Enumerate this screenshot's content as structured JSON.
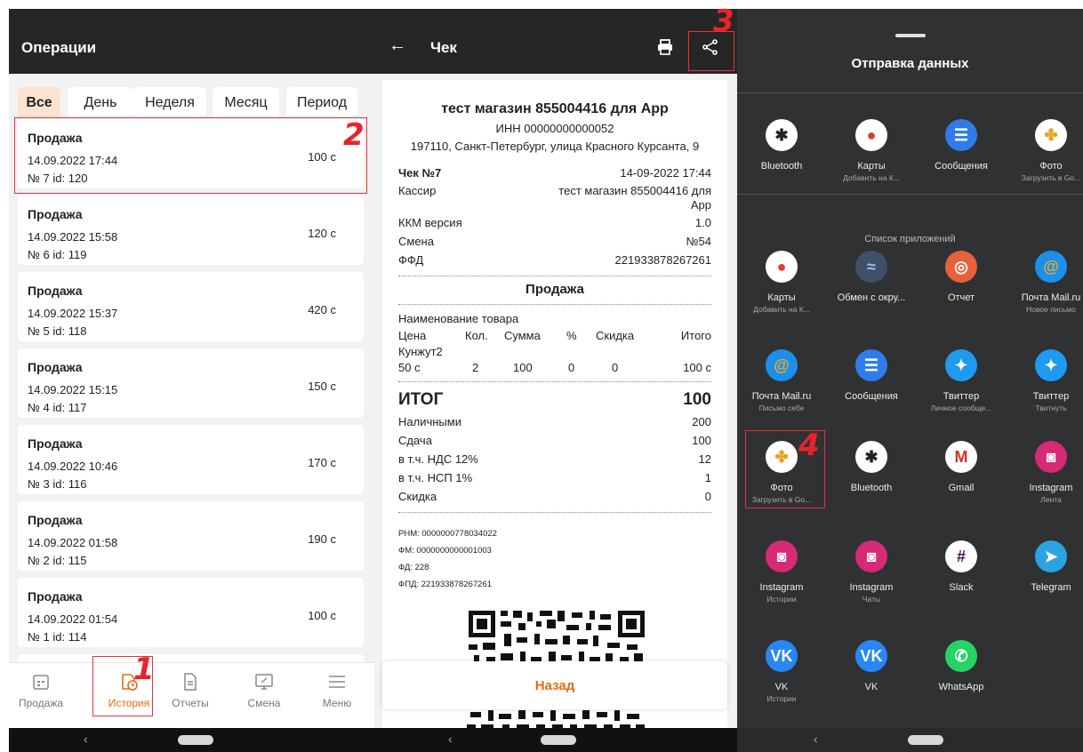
{
  "panel1": {
    "title": "Операции",
    "filters": [
      "Все",
      "День",
      "Неделя",
      "Месяц",
      "Период"
    ],
    "operations": [
      {
        "type": "Продажа",
        "date": "14.09.2022 17:44",
        "num": "№ 7 id: 120",
        "amount": "100 с"
      },
      {
        "type": "Продажа",
        "date": "14.09.2022 15:58",
        "num": "№ 6 id: 119",
        "amount": "120 с"
      },
      {
        "type": "Продажа",
        "date": "14.09.2022 15:37",
        "num": "№ 5 id: 118",
        "amount": "420 с"
      },
      {
        "type": "Продажа",
        "date": "14.09.2022 15:15",
        "num": "№ 4 id: 117",
        "amount": "150 с"
      },
      {
        "type": "Продажа",
        "date": "14.09.2022 10:46",
        "num": "№ 3 id: 116",
        "amount": "170 с"
      },
      {
        "type": "Продажа",
        "date": "14.09.2022 01:58",
        "num": "№ 2 id: 115",
        "amount": "190 с"
      },
      {
        "type": "Продажа",
        "date": "14.09.2022 01:54",
        "num": "№ 1 id: 114",
        "amount": "100 с"
      }
    ],
    "nav": [
      "Продажа",
      "История",
      "Отчеты",
      "Смена",
      "Меню"
    ]
  },
  "panel2": {
    "title": "Чек",
    "shop": "тест магазин 855004416 для App",
    "inn": "ИНН 00000000000052",
    "address": "197110, Санкт-Петербург, улица Красного Курсанта, 9",
    "check_no": "Чек №7",
    "check_date": "14-09-2022 17:44",
    "cashier_label": "Кассир",
    "cashier_value_1": "тест магазин 855004416 для",
    "cashier_value_2": "App",
    "kkm_label": "ККМ версия",
    "kkm_value": "1.0",
    "shift_label": "Смена",
    "shift_value": "№54",
    "ffd_label": "ФФД",
    "ffd_value": "221933878267261",
    "section": "Продажа",
    "col_name": "Наименование товара",
    "cols": [
      "Цена",
      "Кол.",
      "Сумма",
      "%",
      "Скидка",
      "Итого"
    ],
    "item_name": "Кунжут2",
    "item_vals": [
      "50 с",
      "2",
      "100",
      "0",
      "0",
      "100 с"
    ],
    "total_label": "ИТОГ",
    "total_value": "100",
    "cash_label": "Наличными",
    "cash_value": "200",
    "change_label": "Сдача",
    "change_value": "100",
    "vat_label": "в т.ч. НДС 12%",
    "vat_value": "12",
    "nsp_label": "в т.ч. НСП 1%",
    "nsp_value": "1",
    "disc_label": "Скидка",
    "disc_value": "0",
    "rnm": "РНМ: 0000000778034022",
    "fm": "ФМ: 0000000000001003",
    "fd": "ФД: 228",
    "fpd": "ФПД: 221933878267261",
    "back": "Назад"
  },
  "panel3": {
    "title": "Отправка данных",
    "list_title": "Список приложений",
    "top_apps": [
      {
        "name": "Bluetooth",
        "sub": "",
        "icon": "bluetooth-icon",
        "bg": "#ffffff",
        "fg": "#222222",
        "glyph": "✱"
      },
      {
        "name": "Карты",
        "sub": "Добавить на К...",
        "icon": "maps-icon",
        "bg": "#ffffff",
        "fg": "#e23b2c",
        "glyph": "●"
      },
      {
        "name": "Сообщения",
        "sub": "",
        "icon": "messages-icon",
        "bg": "#2f7bea",
        "fg": "#ffffff",
        "glyph": "☰"
      },
      {
        "name": "Фото",
        "sub": "Загрузить в Go...",
        "icon": "photos-icon",
        "bg": "#ffffff",
        "fg": "#e8a31e",
        "glyph": "✤"
      }
    ],
    "apps": [
      {
        "name": "Карты",
        "sub": "Добавить на К...",
        "icon": "maps-icon",
        "bg": "#ffffff",
        "fg": "#e23b2c",
        "glyph": "●"
      },
      {
        "name": "Обмен с окру...",
        "sub": "",
        "icon": "nearby-share-icon",
        "bg": "#3f5168",
        "fg": "#9fc1ff",
        "glyph": "≈"
      },
      {
        "name": "Отчет",
        "sub": "",
        "icon": "report-icon",
        "bg": "#e5623a",
        "fg": "#ffffff",
        "glyph": "◎"
      },
      {
        "name": "Почта Mail.ru",
        "sub": "Новое письмо",
        "icon": "mailru-icon",
        "bg": "#1c8fea",
        "fg": "#f7a823",
        "glyph": "@"
      },
      {
        "name": "Почта Mail.ru",
        "sub": "Письмо себе",
        "icon": "mailru-icon",
        "bg": "#1c8fea",
        "fg": "#f7a823",
        "glyph": "@"
      },
      {
        "name": "Сообщения",
        "sub": "",
        "icon": "messages-icon",
        "bg": "#2f7bea",
        "fg": "#ffffff",
        "glyph": "☰"
      },
      {
        "name": "Твиттер",
        "sub": "Личное сообще...",
        "icon": "twitter-icon",
        "bg": "#1d9bf0",
        "fg": "#ffffff",
        "glyph": "✦"
      },
      {
        "name": "Твиттер",
        "sub": "Твитнуть",
        "icon": "twitter-icon",
        "bg": "#1d9bf0",
        "fg": "#ffffff",
        "glyph": "✦"
      },
      {
        "name": "Фото",
        "sub": "Загрузить в Go...",
        "icon": "photos-icon",
        "bg": "#ffffff",
        "fg": "#e8a31e",
        "glyph": "✤"
      },
      {
        "name": "Bluetooth",
        "sub": "",
        "icon": "bluetooth-icon",
        "bg": "#ffffff",
        "fg": "#222222",
        "glyph": "✱"
      },
      {
        "name": "Gmail",
        "sub": "",
        "icon": "gmail-icon",
        "bg": "#ffffff",
        "fg": "#d93025",
        "glyph": "M"
      },
      {
        "name": "Instagram",
        "sub": "Лента",
        "icon": "instagram-icon",
        "bg": "#d62976",
        "fg": "#ffffff",
        "glyph": "◙"
      },
      {
        "name": "Instagram",
        "sub": "Истории",
        "icon": "instagram-icon",
        "bg": "#d62976",
        "fg": "#ffffff",
        "glyph": "◙"
      },
      {
        "name": "Instagram",
        "sub": "Чаты",
        "icon": "instagram-icon",
        "bg": "#d62976",
        "fg": "#ffffff",
        "glyph": "◙"
      },
      {
        "name": "Slack",
        "sub": "",
        "icon": "slack-icon",
        "bg": "#ffffff",
        "fg": "#4a154b",
        "glyph": "#"
      },
      {
        "name": "Telegram",
        "sub": "",
        "icon": "telegram-icon",
        "bg": "#2aa3e0",
        "fg": "#ffffff",
        "glyph": "➤"
      },
      {
        "name": "VK",
        "sub": "Истории",
        "icon": "vk-icon",
        "bg": "#2787f5",
        "fg": "#ffffff",
        "glyph": "VK"
      },
      {
        "name": "VK",
        "sub": "",
        "icon": "vk-icon",
        "bg": "#2787f5",
        "fg": "#ffffff",
        "glyph": "VK"
      },
      {
        "name": "WhatsApp",
        "sub": "",
        "icon": "whatsapp-icon",
        "bg": "#25d366",
        "fg": "#ffffff",
        "glyph": "✆"
      }
    ]
  },
  "markers": [
    "1",
    "2",
    "3",
    "4"
  ],
  "colors": {
    "accent": "#e86a12",
    "annotation": "#e8232b",
    "dark": "#262626"
  }
}
